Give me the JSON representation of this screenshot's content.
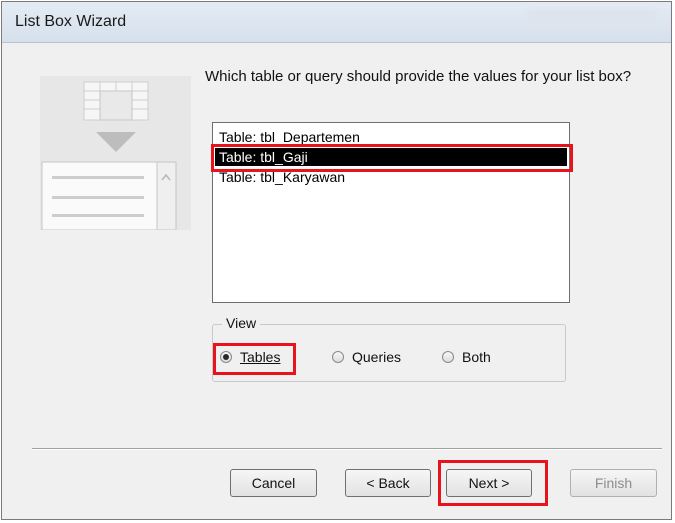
{
  "window": {
    "title": "List Box Wizard"
  },
  "prompt": "Which table or query should provide the values for your list box?",
  "list": {
    "items": [
      {
        "label": "Table: tbl_Departemen",
        "selected": false
      },
      {
        "label": "Table: tbl_Gaji",
        "selected": true
      },
      {
        "label": "Table: tbl_Karyawan",
        "selected": false
      }
    ]
  },
  "view": {
    "legend": "View",
    "options": [
      {
        "label": "Tables",
        "checked": true
      },
      {
        "label": "Queries",
        "checked": false
      },
      {
        "label": "Both",
        "checked": false
      }
    ]
  },
  "buttons": {
    "cancel": "Cancel",
    "back": "< Back",
    "next": "Next >",
    "finish": "Finish"
  },
  "colors": {
    "highlight_box": "#e8141b",
    "selection_bg": "#000000"
  }
}
